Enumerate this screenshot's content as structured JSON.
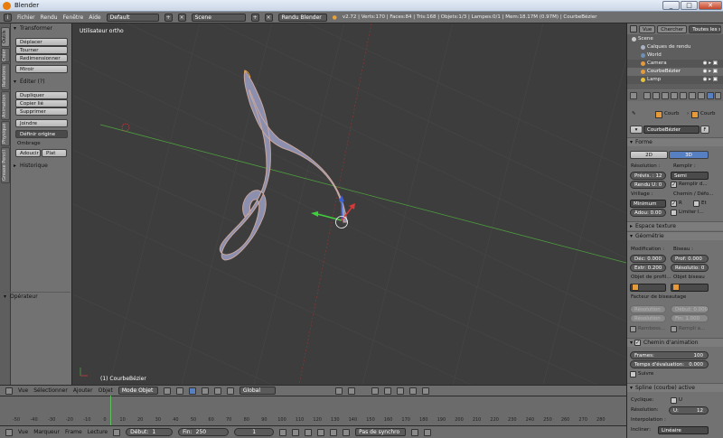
{
  "window": {
    "title": "Blender",
    "controls": [
      "_",
      "□",
      "✕"
    ]
  },
  "infobar": {
    "menus": [
      "Fichier",
      "Rendu",
      "Fenêtre",
      "Aide"
    ],
    "layout": "Default",
    "scene": "Scene",
    "engine": "Rendu Blender",
    "stats": "v2.72 | Verts:170 | Faces:84 | Tris:168 | Objets:1/3 | Lampes:0/1 | Mem:18.17M (0.97M) | CourbeBézier"
  },
  "toolshelf": {
    "tabs": [
      "Outils",
      "Créer",
      "Relations",
      "Animation",
      "Physique",
      "Grease Pencil"
    ],
    "transform_header": "Transformer",
    "transform_buttons": [
      "Déplacer",
      "Tourner",
      "Redimensionner"
    ],
    "mirror": "Miroir",
    "edit_header": "Éditer (?)",
    "edit_buttons": [
      "Dupliquer",
      "Copier lié",
      "Supprimer"
    ],
    "join": "Joindre",
    "set_origin": "Définir origine",
    "shading_label": "Ombrage",
    "smooth": "Adoucir",
    "flat": "Plat",
    "history": "Historique",
    "operator": "Opérateur"
  },
  "viewport": {
    "view_label": "Utilisateur ortho",
    "object_label": "(1) CourbeBézier"
  },
  "v3dheader": {
    "menus": [
      "Vue",
      "Sélectionner",
      "Ajouter",
      "Objet"
    ],
    "mode": "Mode Objet",
    "orientation": "Global"
  },
  "timeline": {
    "ticks": [
      "-50",
      "-40",
      "-30",
      "-20",
      "-10",
      "0",
      "10",
      "20",
      "30",
      "40",
      "50",
      "60",
      "70",
      "80",
      "90",
      "100",
      "110",
      "120",
      "130",
      "140",
      "150",
      "160",
      "170",
      "180",
      "190",
      "200",
      "210",
      "220",
      "230",
      "240",
      "250",
      "260",
      "270",
      "280"
    ],
    "menus": [
      "Vue",
      "Marqueur",
      "Frame",
      "Lecture"
    ],
    "start_label": "Début:",
    "start_value": "1",
    "end_label": "Fin:",
    "end_value": "250",
    "current": "1",
    "sync": "Pas de synchro"
  },
  "outliner": {
    "tabs": [
      "Vue",
      "Chercher",
      "Toutes les scènes"
    ],
    "items": [
      "Scene",
      "Calques de rendu",
      "World",
      "Camera",
      "CourbeBézier",
      "Lamp"
    ]
  },
  "properties": {
    "breadcrumb": [
      "Courb",
      "Courb"
    ],
    "datablock": "CourbeBézier",
    "datablock_f": "F",
    "shape_header": "Forme",
    "dim_2d": "2D",
    "dim_3d": "3D",
    "resolution_label": "Résolution :",
    "fill_label": "Remplir :",
    "preview": "Prévis. : 12",
    "render_u": "Rendu U: 0",
    "fill_mode": "Semi",
    "fill_deformed": "Remplir d...",
    "twisting_label": "Vrillage :",
    "path_label": "Chemin / Défo...",
    "twist_mode": "Minimum",
    "radius_r": "R",
    "stretch": "Et",
    "smooth": "Adou: 0.00",
    "bounds_clamp": "Limiter l...",
    "texture_space": "Espace texture",
    "geometry_header": "Géométrie",
    "modification_label": "Modification :",
    "bevel_label": "Biseau :",
    "offset": "Déc: 0.000",
    "depth": "Prof: 0.000",
    "extrude": "Extr: 0.200",
    "bevel_res": "Résolutio: 0",
    "taper_label": "Objet de profil...",
    "bevel_obj_label": "Objet biseau",
    "bevel_factor": "Facteur de biseautage",
    "res_left": "Résolution",
    "start_right": "Début: 0.000",
    "res_left2": "Résolution",
    "end_right": "Fin: 1.000",
    "fill_caps": "Remboss...",
    "map_taper": "Rempli a...",
    "path_anim_header": "Chemin d'animation",
    "frames": "Frames:",
    "frames_value": "100",
    "eval_time": "Temps d'évaluation:",
    "eval_value": "0.000",
    "follow": "Suivre",
    "active_spline_header": "Spline (courbe) active",
    "cyclic": "Cyclique:",
    "cyclic_u": "U",
    "resolution2": "Résolution:",
    "u_value": "U:",
    "u_number": "12",
    "interpolation": "Interpolation :",
    "tilt_label": "Incliner:",
    "tilt_value": "Linéaire"
  },
  "colors": {
    "accent_blue": "#5680c2",
    "x_axis": "#a43535",
    "y_axis": "#4da13d",
    "curve_fill": "#8d8fae",
    "selection": "#f2a43a"
  }
}
